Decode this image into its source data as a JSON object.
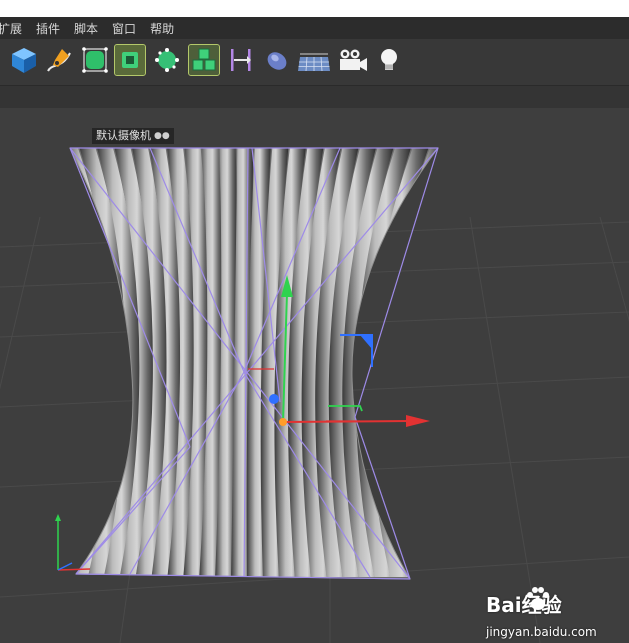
{
  "menubar": {
    "items": [
      {
        "label": "扩展"
      },
      {
        "label": "插件"
      },
      {
        "label": "脚本"
      },
      {
        "label": "窗口"
      },
      {
        "label": "帮助"
      }
    ]
  },
  "toolbar": {
    "tools": [
      {
        "icon": "cube-icon"
      },
      {
        "icon": "pen-spline-icon"
      },
      {
        "icon": "subdivision-surface-icon"
      },
      {
        "icon": "array-icon"
      },
      {
        "icon": "deformer-icon"
      },
      {
        "icon": "mograph-cloner-icon"
      },
      {
        "icon": "bend-deformer-icon"
      },
      {
        "icon": "field-sphere-icon"
      },
      {
        "icon": "floor-icon"
      },
      {
        "icon": "camera-icon"
      },
      {
        "icon": "light-icon"
      }
    ]
  },
  "viewport": {
    "camera_label": "默认摄像机",
    "camera_icon": "camera-dots-icon"
  },
  "watermark": {
    "brand": "Bai经验",
    "url": "jingyan.baidu.com",
    "icon": "baidu-paw-icon"
  },
  "colors": {
    "axis_y": "#2fd34f",
    "axis_x": "#e23232",
    "axis_z": "#2f70ff",
    "wireframe": "#9e8be8",
    "menu_bg": "#2c2c2c",
    "viewport_bg": "#3e3e3e"
  }
}
